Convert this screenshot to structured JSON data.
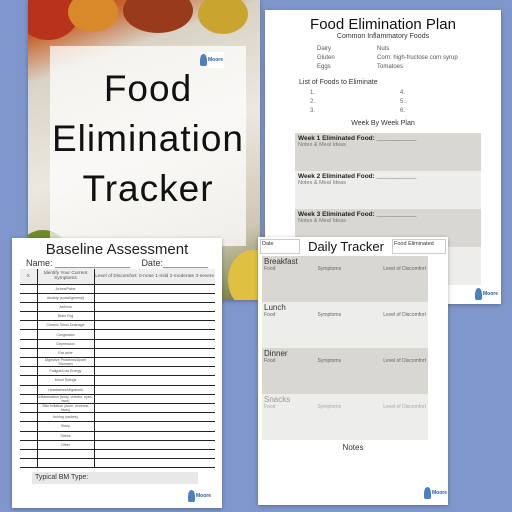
{
  "cover": {
    "title_lines": [
      "Food",
      "Elimination",
      "Tracker"
    ],
    "logo_text": "Moore"
  },
  "plan": {
    "title": "Food Elimination Plan",
    "subtitle": "Common Inflammatory Foods",
    "foods": [
      "Dairy",
      "Nuts",
      "Gluten",
      "Corn: high-fructose corn syrup",
      "Eggs",
      "Tomatoes"
    ],
    "list_title": "List of Foods to Eliminate",
    "list_numbers": [
      "1.",
      "4.",
      "2.",
      "5.",
      "3.",
      "6."
    ],
    "week_title": "Week By Week Plan",
    "weeks": [
      {
        "label": "Week 1 Eliminated Food: ___________",
        "notes": "Notes & Meal Ideas"
      },
      {
        "label": "Week 2 Eliminated Food: ___________",
        "notes": "Notes & Meal Ideas"
      },
      {
        "label": "Week 3 Eliminated Food: ___________",
        "notes": "Notes & Meal Ideas"
      }
    ],
    "logo_text": "Moore"
  },
  "baseline": {
    "title": "Baseline Assessment",
    "name_label": "Name: _______________",
    "date_label": "Date:_________",
    "headers": [
      "X",
      "Identify Your Current Symptoms",
      "Level of Discomfort: 0-none 1-mild 2-moderate 3-severe"
    ],
    "symptoms": [
      "Aches/Pains",
      "Anxiety (social/general)",
      "Asthma",
      "Brain Fog",
      "Chronic Sinus Drainage",
      "Congestion",
      "Depression",
      "Ear ache",
      "Digestive Problems/Upset Stomach",
      "Fatigue/Low Energy",
      "Mood Swings",
      "Headaches/Migraines",
      "Inflammation (body, cheeks, eyes, face)",
      "Skin Irritation (acne, eczema, hives)",
      "Itching (rashes)",
      "Sleep",
      "Stress",
      "Other",
      "",
      ""
    ],
    "bm_label": "Typical BM Type:",
    "logo_text": "Moore"
  },
  "daily": {
    "title": "Daily Tracker",
    "date_label": "Date",
    "food_eliminated_label": "Food Eliminated",
    "meals": [
      {
        "name": "Breakfast",
        "color": "#d9d7d1"
      },
      {
        "name": "Lunch",
        "color": "#ededeb"
      },
      {
        "name": "Dinner",
        "color": "#d9d7d1"
      },
      {
        "name": "Snacks",
        "color": "#ededeb"
      }
    ],
    "columns": [
      "Food",
      "Symptoms",
      "Level of Discomfort"
    ],
    "notes_label": "Notes",
    "logo_text": "Moore"
  }
}
